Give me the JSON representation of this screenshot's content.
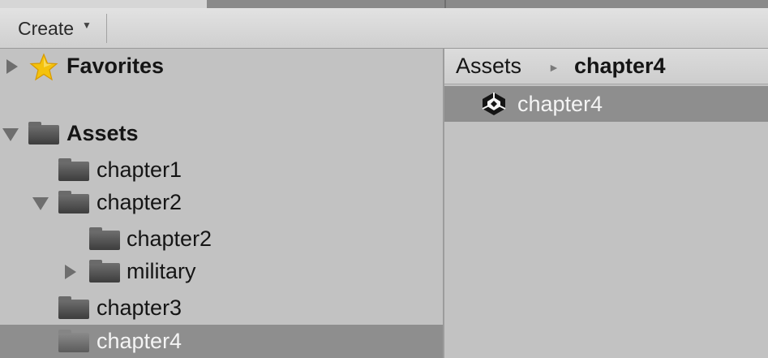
{
  "toolbar": {
    "create_label": "Create",
    "create_caret": "▼"
  },
  "tree": {
    "favorites": {
      "label": "Favorites",
      "icon": "star-icon",
      "expanded": false
    },
    "assets": {
      "label": "Assets",
      "icon": "folder-icon",
      "expanded": true
    },
    "items": [
      {
        "label": "chapter1",
        "icon": "folder-icon"
      },
      {
        "label": "chapter2",
        "icon": "folder-icon",
        "expanded": true
      },
      {
        "label": "chapter2",
        "icon": "folder-icon"
      },
      {
        "label": "military",
        "icon": "folder-icon",
        "expanded": false
      },
      {
        "label": "chapter3",
        "icon": "folder-icon"
      },
      {
        "label": "chapter4",
        "icon": "folder-icon",
        "selected": true
      }
    ]
  },
  "breadcrumb": {
    "root": "Assets",
    "separator": "►",
    "current": "chapter4"
  },
  "assets_view": {
    "items": [
      {
        "label": "chapter4",
        "icon": "unity-scene-icon",
        "selected": true
      }
    ]
  },
  "colors": {
    "panel_bg": "#c2c2c2",
    "selection_bg": "#8e8e8e",
    "selection_text": "#f4f4f4",
    "star_fill": "#f4c20d"
  }
}
